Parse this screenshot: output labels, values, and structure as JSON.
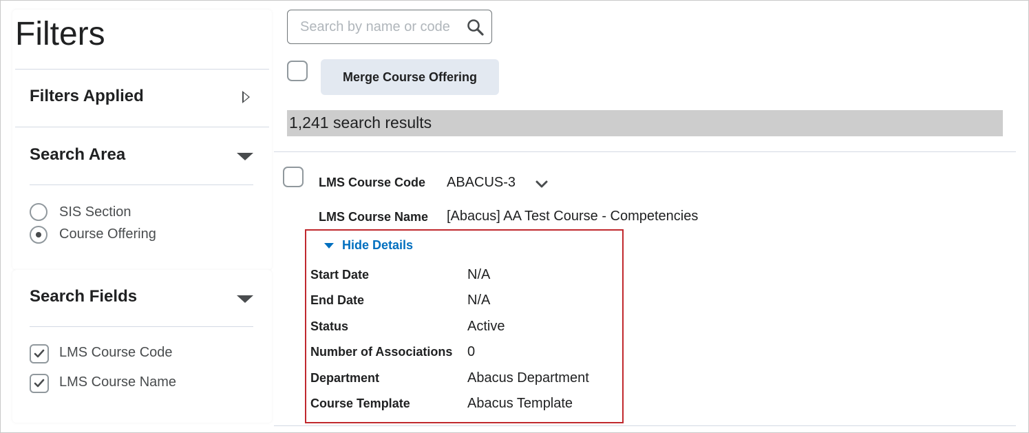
{
  "sidebar": {
    "title": "Filters",
    "filters_applied": {
      "title": "Filters Applied"
    },
    "search_area": {
      "title": "Search Area",
      "options": [
        {
          "label": "SIS Section",
          "selected": false
        },
        {
          "label": "Course Offering",
          "selected": true
        }
      ]
    },
    "search_fields": {
      "title": "Search Fields",
      "options": [
        {
          "label": "LMS Course Code",
          "checked": true
        },
        {
          "label": "LMS Course Name",
          "checked": true
        }
      ]
    }
  },
  "search": {
    "placeholder": "Search by name or code",
    "value": ""
  },
  "toolbar": {
    "merge_label": "Merge Course Offering"
  },
  "results": {
    "count_text": "1,241 search results"
  },
  "course": {
    "code_label": "LMS Course Code",
    "code_value": "ABACUS-3",
    "name_label": "LMS Course Name",
    "name_value": "[Abacus] AA Test Course - Competencies",
    "toggle_label": "Hide Details",
    "details": [
      {
        "label": "Start Date",
        "value": "N/A"
      },
      {
        "label": "End Date",
        "value": "N/A"
      },
      {
        "label": "Status",
        "value": "Active"
      },
      {
        "label": "Number of Associations",
        "value": "0"
      },
      {
        "label": "Department",
        "value": "Abacus Department"
      },
      {
        "label": "Course Template",
        "value": "Abacus Template"
      }
    ]
  },
  "colors": {
    "accent": "#006fbf",
    "highlight_border": "#c0282d",
    "results_bar": "#cdcdcd",
    "button_bg": "#e3e9f1"
  },
  "icons": {
    "search": "search-icon",
    "chevron": "chevron-down-icon",
    "check": "check-icon"
  }
}
